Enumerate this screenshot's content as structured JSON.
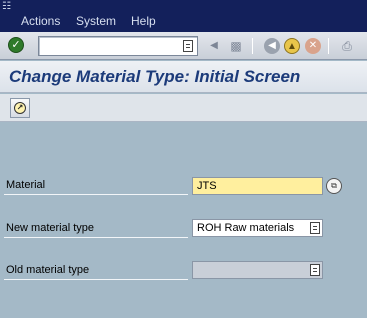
{
  "menubar": {
    "items": [
      {
        "label": "Actions"
      },
      {
        "label": "System"
      },
      {
        "label": "Help"
      }
    ]
  },
  "toolbar": {
    "command_field_value": "",
    "icons": [
      "enter-icon",
      "back-arrow-icon",
      "save-icon",
      "back-icon",
      "exit-icon",
      "cancel-icon",
      "print-icon"
    ]
  },
  "title": "Change Material Type: Initial Screen",
  "form": {
    "material": {
      "label": "Material",
      "value": "JTS"
    },
    "new_type": {
      "label": "New material type",
      "value": "ROH Raw materials"
    },
    "old_type": {
      "label": "Old material type",
      "value": ""
    }
  },
  "colors": {
    "menubar": "#13205b",
    "background": "#a4b9c7",
    "title": "#1c3b7a",
    "required_field": "#ffef9e"
  }
}
